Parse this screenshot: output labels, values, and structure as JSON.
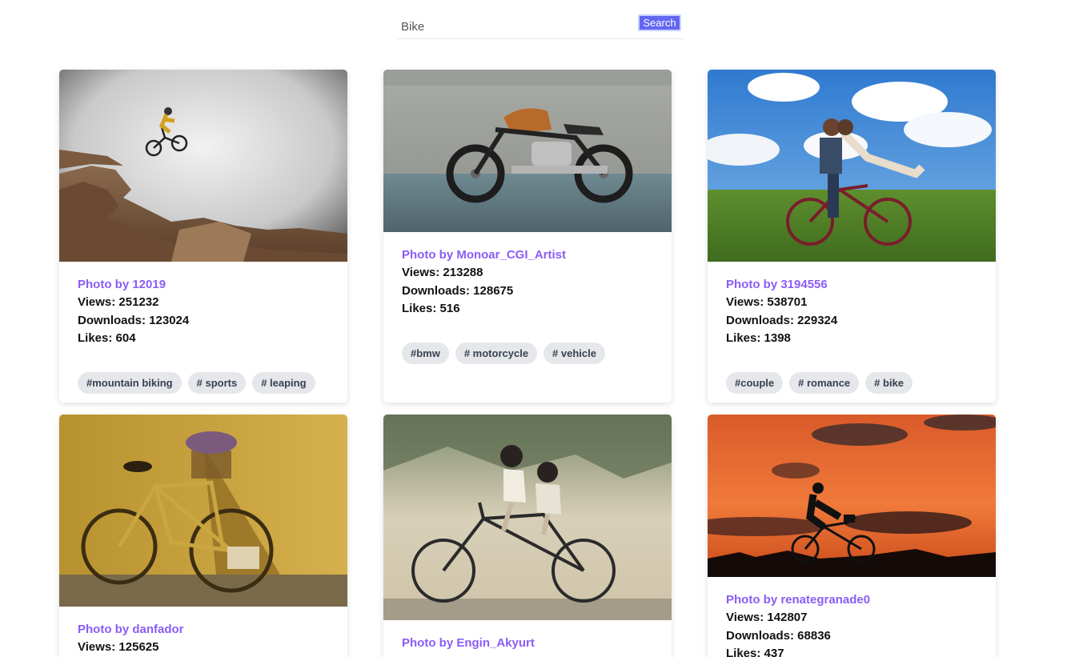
{
  "search": {
    "value": "Bike",
    "button_label": "Search"
  },
  "cards": [
    {
      "author": "Photo by 12019",
      "views_label": "Views:",
      "views": "251232",
      "downloads_label": "Downloads:",
      "downloads": "123024",
      "likes_label": "Likes:",
      "likes": "604",
      "tags": [
        "#mountain biking",
        "# sports",
        "# leaping"
      ]
    },
    {
      "author": "Photo by Monoar_CGI_Artist",
      "views_label": "Views:",
      "views": "213288",
      "downloads_label": "Downloads:",
      "downloads": "128675",
      "likes_label": "Likes:",
      "likes": "516",
      "tags": [
        "#bmw",
        "# motorcycle",
        "# vehicle"
      ]
    },
    {
      "author": "Photo by 3194556",
      "views_label": "Views:",
      "views": "538701",
      "downloads_label": "Downloads:",
      "downloads": "229324",
      "likes_label": "Likes:",
      "likes": "1398",
      "tags": [
        "#couple",
        "# romance",
        "# bike"
      ]
    },
    {
      "author": "Photo by danfador",
      "views_label": "Views:",
      "views": "125625"
    },
    {
      "author": "Photo by Engin_Akyurt"
    },
    {
      "author": "Photo by renategranade0",
      "views_label": "Views:",
      "views": "142807",
      "downloads_label": "Downloads:",
      "downloads": "68836",
      "likes_label": "Likes:",
      "likes": "437"
    }
  ],
  "colors": {
    "accent": "#8b5cf6",
    "button": "#6366f1",
    "tag_bg": "#e5e7eb"
  }
}
